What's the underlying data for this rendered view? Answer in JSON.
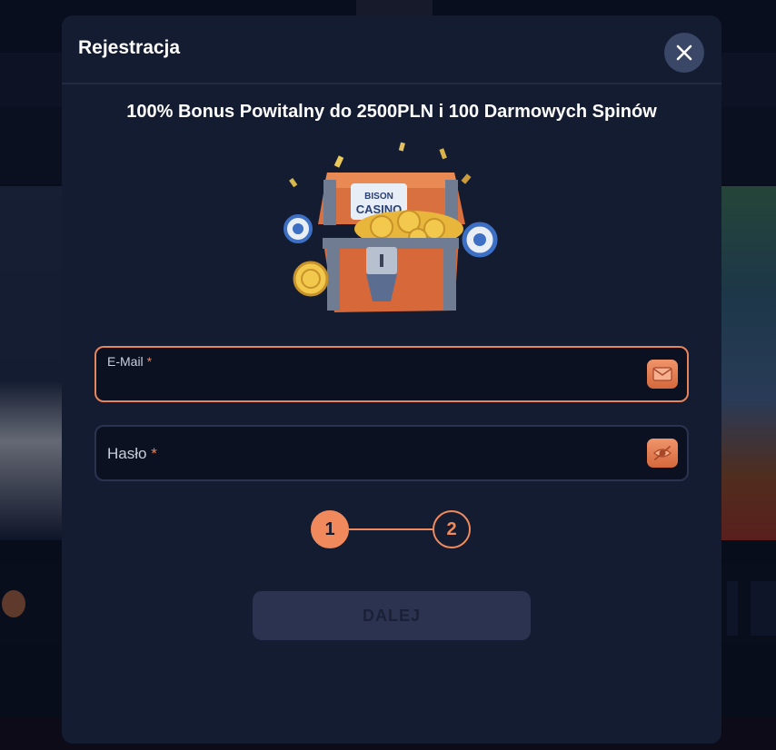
{
  "modal": {
    "title": "Rejestracja",
    "promo_text": "100% Bonus Powitalny do 2500PLN i 100 Darmowych Spinów",
    "chest_logo_line1": "BISON",
    "chest_logo_line2": "CASINO"
  },
  "form": {
    "email": {
      "label": "E-Mail",
      "required_mark": "*",
      "value": "",
      "icon": "envelope-icon"
    },
    "password": {
      "label": "Hasło",
      "required_mark": "*",
      "value": "",
      "icon": "eye-hidden-icon"
    }
  },
  "steps": {
    "items": [
      "1",
      "2"
    ],
    "current": 1
  },
  "next_button": {
    "label": "DALEJ",
    "enabled": false
  },
  "colors": {
    "accent": "#f08a5d",
    "modal_bg": "#141c31",
    "field_bg": "#0b1120"
  }
}
